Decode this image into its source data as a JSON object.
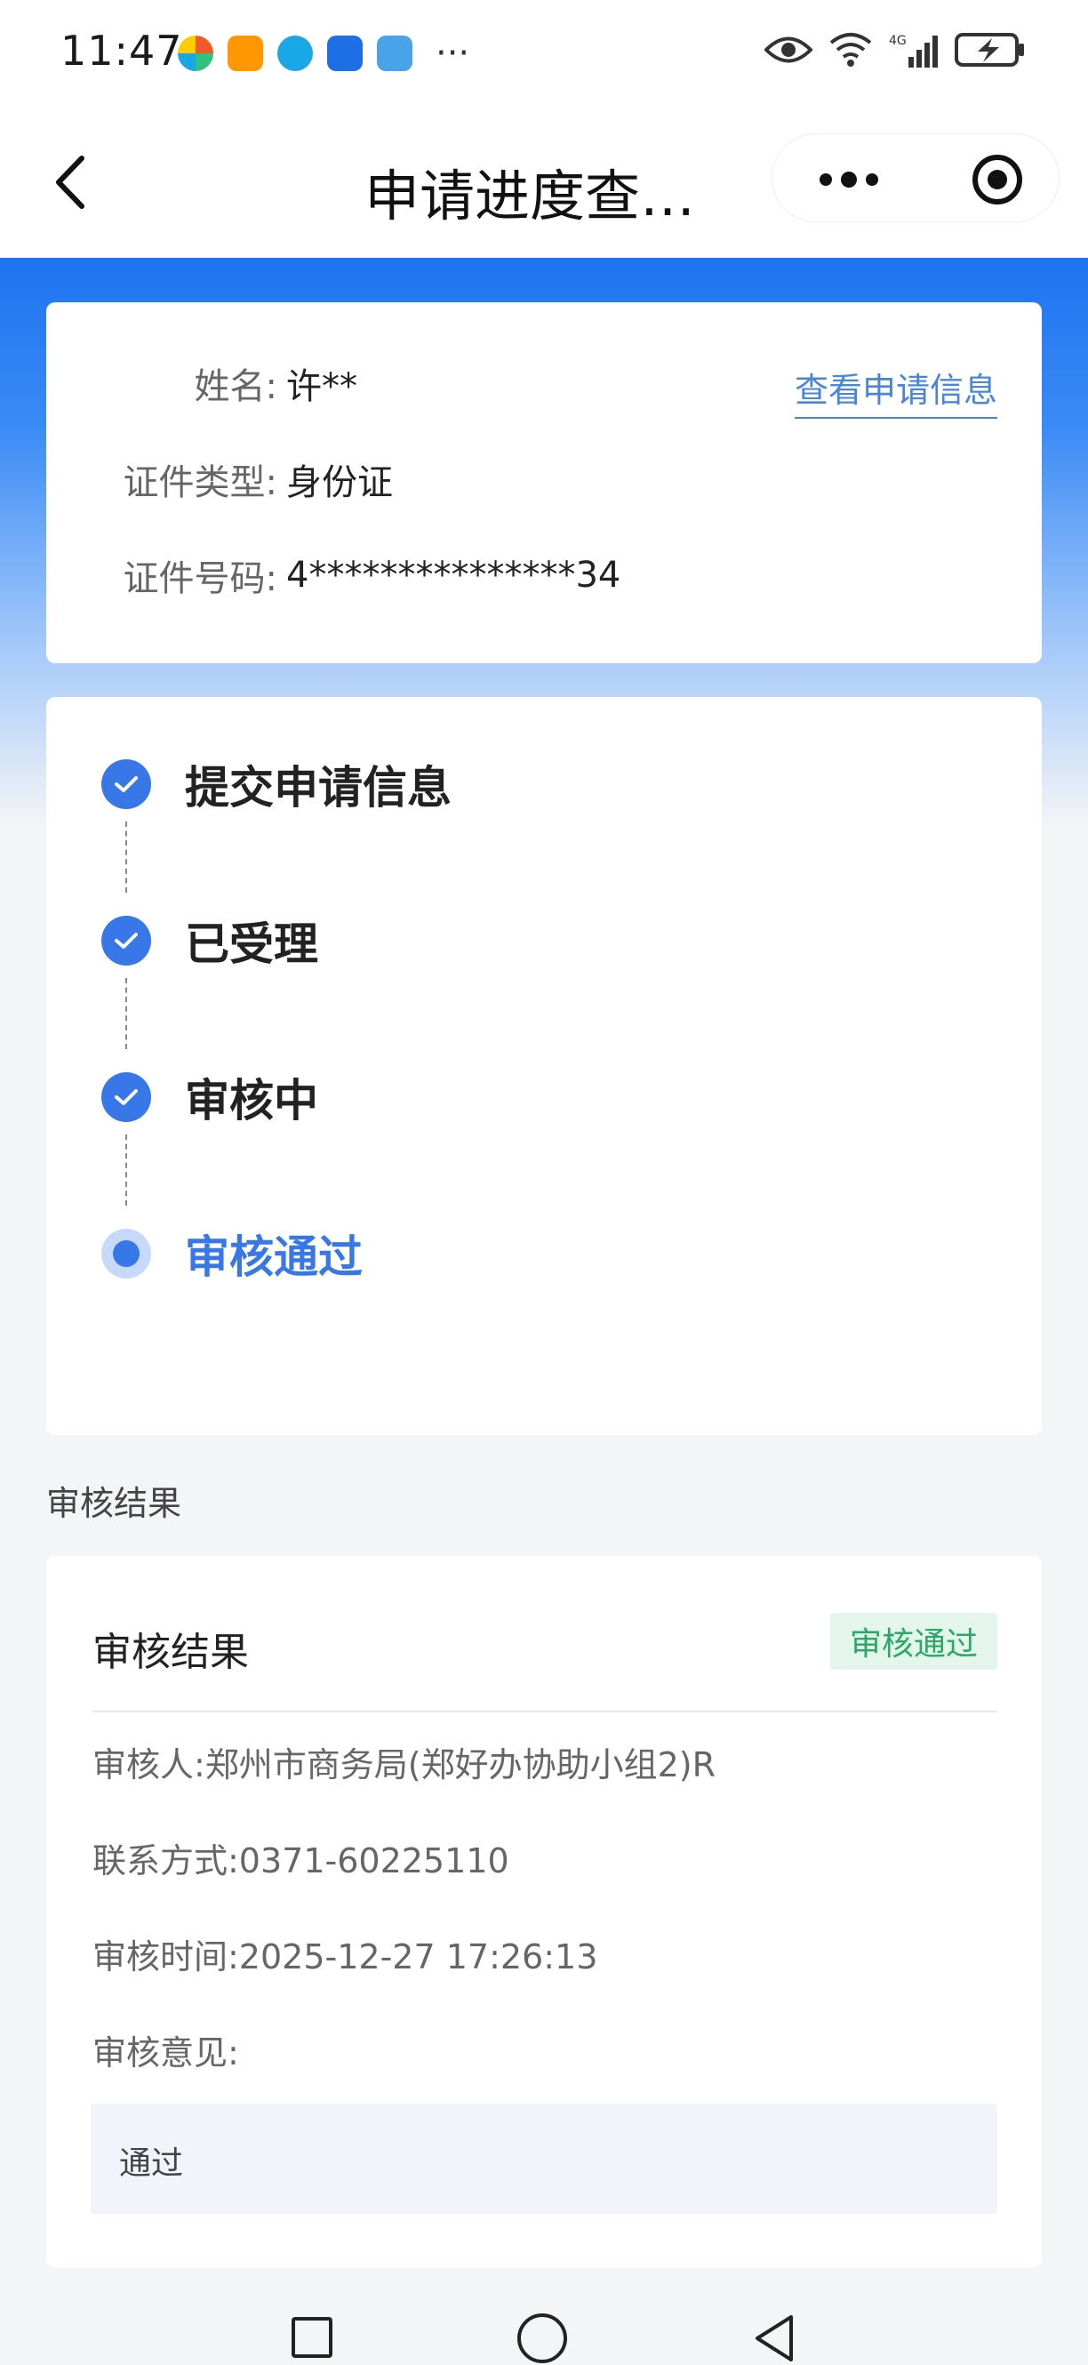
{
  "status_bar": {
    "time": "11:47",
    "more": "···",
    "app_colors": [
      "#f05a28",
      "#ff9800",
      "#1aa7e8",
      "#1e6fe6",
      "#4aa3e8"
    ]
  },
  "nav": {
    "title": "申请进度查…"
  },
  "applicant": {
    "name_label": "姓名:",
    "name_value": "许**",
    "id_type_label": "证件类型:",
    "id_type_value": "身份证",
    "id_number_label": "证件号码:",
    "id_number_value": "4***************34",
    "view_link": "查看申请信息"
  },
  "progress": {
    "steps": [
      {
        "label": "提交申请信息",
        "state": "done"
      },
      {
        "label": "已受理",
        "state": "done"
      },
      {
        "label": "审核中",
        "state": "done"
      },
      {
        "label": "审核通过",
        "state": "current"
      }
    ]
  },
  "review_section_title": "审核结果",
  "review": {
    "heading": "审核结果",
    "badge": "审核通过",
    "reviewer": "审核人:郑州市商务局(郑好办协助小组2)R",
    "contact": "联系方式:0371-60225110",
    "time": "审核时间:2025-12-27 17:26:13",
    "opinion_label": "审核意见:",
    "opinion": "通过"
  },
  "colors": {
    "accent": "#3777e8",
    "success": "#2aa866"
  }
}
